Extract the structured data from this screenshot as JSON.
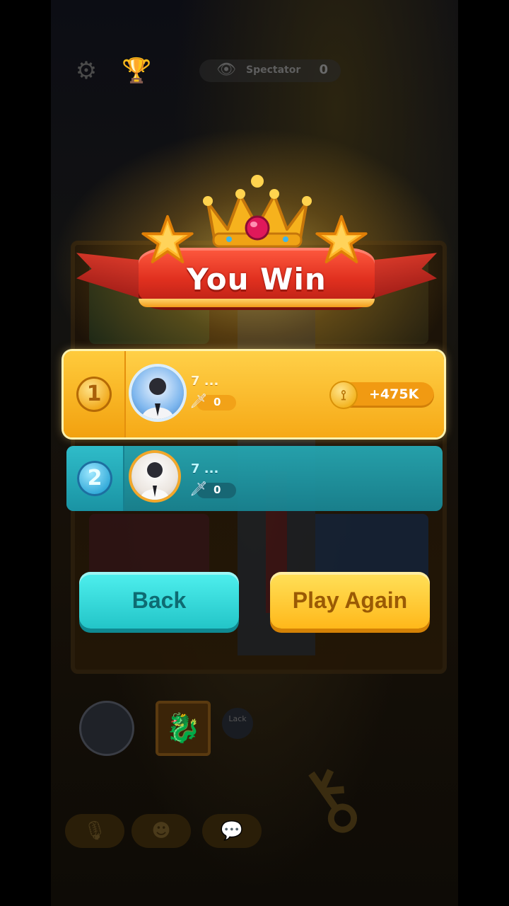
{
  "header": {
    "spectator_label": "Spectator",
    "spectator_count": "0",
    "settings_icon": "gear-icon",
    "trophy_icon": "trophy-icon",
    "eye_icon": "eye-icon"
  },
  "banner": {
    "title": "You Win"
  },
  "results": [
    {
      "rank": "1",
      "name": "7 ...",
      "score": "0",
      "reward": "+475K",
      "icon": "coin-icon"
    },
    {
      "rank": "2",
      "name": "7 ...",
      "score": "0"
    }
  ],
  "buttons": {
    "back": "Back",
    "play_again": "Play Again"
  },
  "bottom": {
    "lack_label": "Lack"
  },
  "colors": {
    "gold": "#f6a916",
    "teal": "#1f9fae",
    "ribbon": "#e0301f",
    "back_button": "#2fd3d6",
    "play_button": "#ffc524"
  }
}
